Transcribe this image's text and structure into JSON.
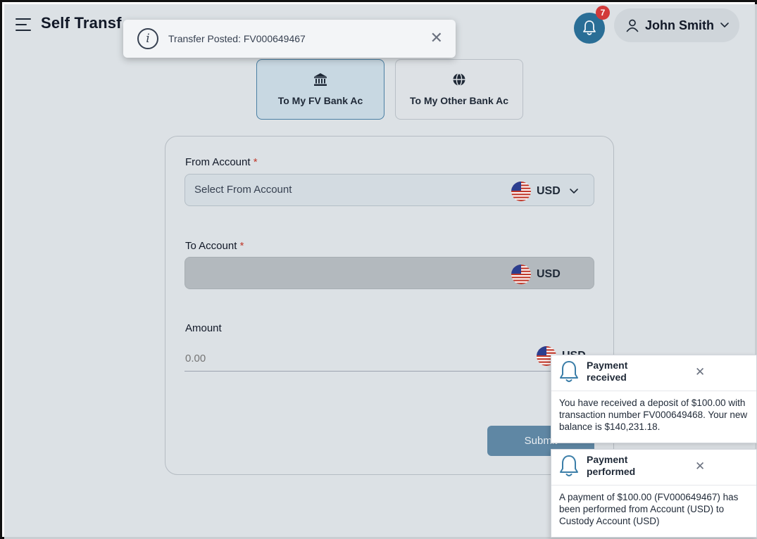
{
  "header": {
    "title": "Self Transf",
    "notification_count": "7",
    "user_name": "John Smith"
  },
  "toast": {
    "message": "Transfer Posted: FV000649467",
    "close_glyph": "✕"
  },
  "tabs": [
    {
      "label": "To My FV Bank Ac",
      "icon": "bank-icon",
      "active": true
    },
    {
      "label": "To My Other Bank Ac",
      "icon": "globe-icon",
      "active": false
    }
  ],
  "form": {
    "from_account": {
      "label": "From Account",
      "required_mark": "*",
      "placeholder": "Select From Account",
      "currency": "USD"
    },
    "to_account": {
      "label": "To Account",
      "required_mark": "*",
      "currency": "USD"
    },
    "amount": {
      "label": "Amount",
      "placeholder": "0.00",
      "currency": "USD"
    },
    "submit_label": "Submit"
  },
  "notifications": [
    {
      "title": "Payment received",
      "body": "You have received a deposit of $100.00 with transaction number FV000649468. Your new balance is $140,231.18.",
      "close_glyph": "✕"
    },
    {
      "title": "Payment performed",
      "body": "A payment of $100.00 (FV000649467) has been performed from Account (USD) to Custody Account (USD)",
      "close_glyph": "✕"
    }
  ],
  "colors": {
    "accent": "#2a6e96",
    "badge": "#d23a3a",
    "submit": "#5f87a4",
    "overlay": "#d9dee3"
  }
}
